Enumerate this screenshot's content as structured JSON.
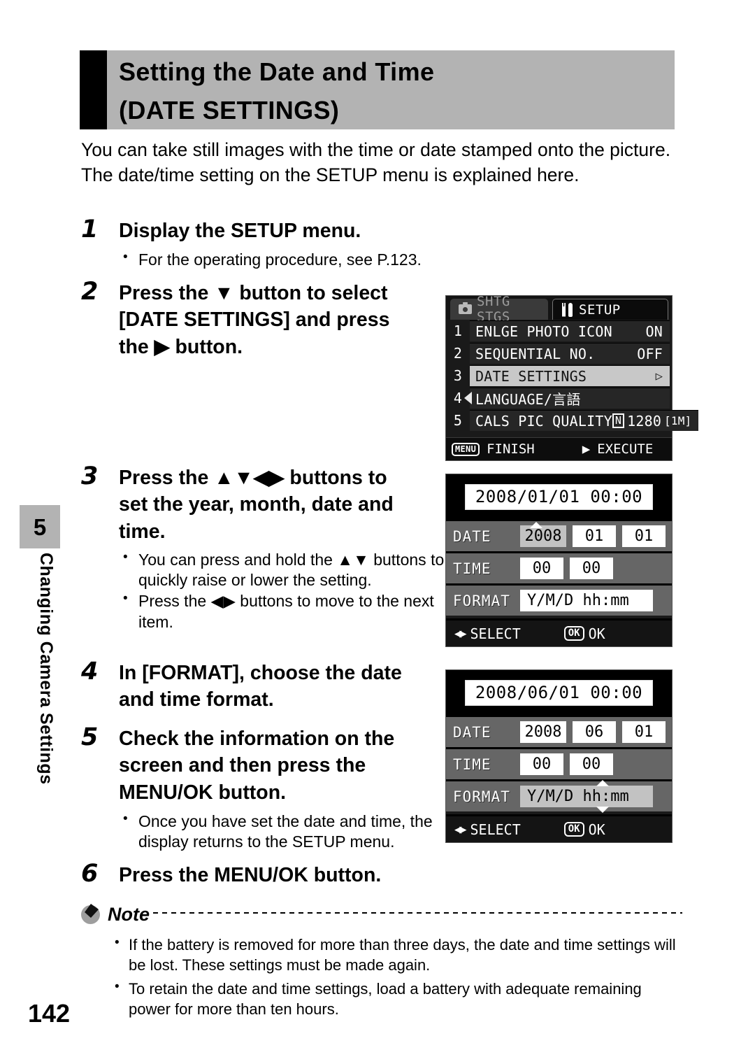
{
  "header": {
    "title_line1": "Setting the Date and Time",
    "title_line2": "(DATE SETTINGS)"
  },
  "intro": {
    "line1": "You can take still images with the time or date stamped onto the picture.",
    "line2": "The date/time setting on the SETUP menu is explained here."
  },
  "steps": [
    {
      "num": "1",
      "heading": "Display the SETUP menu.",
      "bullets": [
        "For the operating procedure, see P.123."
      ]
    },
    {
      "num": "2",
      "heading_l1": "Press the ▼ button to select",
      "heading_l2": "[DATE SETTINGS] and press",
      "heading_l3": "the ▶ button.",
      "bullets": []
    },
    {
      "num": "3",
      "heading_l1": "Press the ▲▼◀▶ buttons to",
      "heading_l2": "set the year, month, date and",
      "heading_l3": "time.",
      "bullets": [
        "You can press and hold the ▲▼ buttons to quickly raise or lower the setting.",
        "Press the ◀▶ buttons to move to the next item."
      ]
    },
    {
      "num": "4",
      "heading_l1": "In [FORMAT], choose the date",
      "heading_l2": "and time format.",
      "bullets": []
    },
    {
      "num": "5",
      "heading_l1": "Check the information on the",
      "heading_l2": "screen and then press the",
      "heading_l3": "MENU/OK button.",
      "bullets": [
        "Once you have set the date and time, the display returns to the SETUP menu."
      ]
    },
    {
      "num": "6",
      "heading": "Press the MENU/OK button.",
      "bullets": []
    }
  ],
  "setup_screen": {
    "tab_inactive": "SHTG STGS",
    "tab_inactive_icon": "camera-icon",
    "tab_active": "SETUP",
    "tab_active_icon": "tool-icon",
    "rows": [
      {
        "index": "1",
        "label": "ENLGE PHOTO ICON",
        "value": "ON",
        "selected": false
      },
      {
        "index": "2",
        "label": "SEQUENTIAL NO.",
        "value": "OFF",
        "selected": false
      },
      {
        "index": "3",
        "label": "DATE SETTINGS",
        "value": "▷",
        "selected": true
      },
      {
        "index": "4",
        "label": "LANGUAGE/言語",
        "value": "",
        "selected": false
      },
      {
        "index": "5",
        "label": "CALS PIC QUALITY",
        "value_badge": "N",
        "value_num": "1280",
        "value_size": "[1M]",
        "selected": false
      }
    ],
    "footer_key": "MENU",
    "footer_left": "FINISH",
    "footer_arrow": "▶",
    "footer_right": "EXECUTE"
  },
  "date_screen_1": {
    "preview": "2008/01/01 00:00",
    "rows": [
      {
        "label": "DATE",
        "cells": [
          "2008",
          "01",
          "01"
        ],
        "selected_index": 0
      },
      {
        "label": "TIME",
        "cells": [
          "00",
          "00"
        ],
        "selected_index": -1
      },
      {
        "label": "FORMAT",
        "cells": [
          "Y/M/D hh:mm"
        ],
        "selected_index": -1
      }
    ],
    "footer_arrows": "◀▶",
    "footer_left": "SELECT",
    "footer_key": "OK",
    "footer_right": "OK"
  },
  "date_screen_2": {
    "preview": "2008/06/01 00:00",
    "rows": [
      {
        "label": "DATE",
        "cells": [
          "2008",
          "06",
          "01"
        ],
        "selected_index": -1
      },
      {
        "label": "TIME",
        "cells": [
          "00",
          "00"
        ],
        "selected_index": -1
      },
      {
        "label": "FORMAT",
        "cells": [
          "Y/M/D hh:mm"
        ],
        "selected_index": 0
      }
    ],
    "footer_arrows": "◀▶",
    "footer_left": "SELECT",
    "footer_key": "OK",
    "footer_right": "OK"
  },
  "note": {
    "label": "Note",
    "bullets": [
      "If the battery is removed for more than three days, the date and time settings will be lost. These settings must be made again.",
      "To retain the date and time settings, load a battery with adequate remaining power for more than ten hours."
    ]
  },
  "sidebar": {
    "chapter_number": "5",
    "chapter_title": "Changing Camera Settings"
  },
  "page_number": "142",
  "colors": {
    "banner_gray": "#b3b3b3",
    "lcd_dark": "#1a1a1a",
    "lcd_row": "#262626",
    "lcd_selected": "#c8c8c8",
    "dt_row_gray": "#666666"
  }
}
